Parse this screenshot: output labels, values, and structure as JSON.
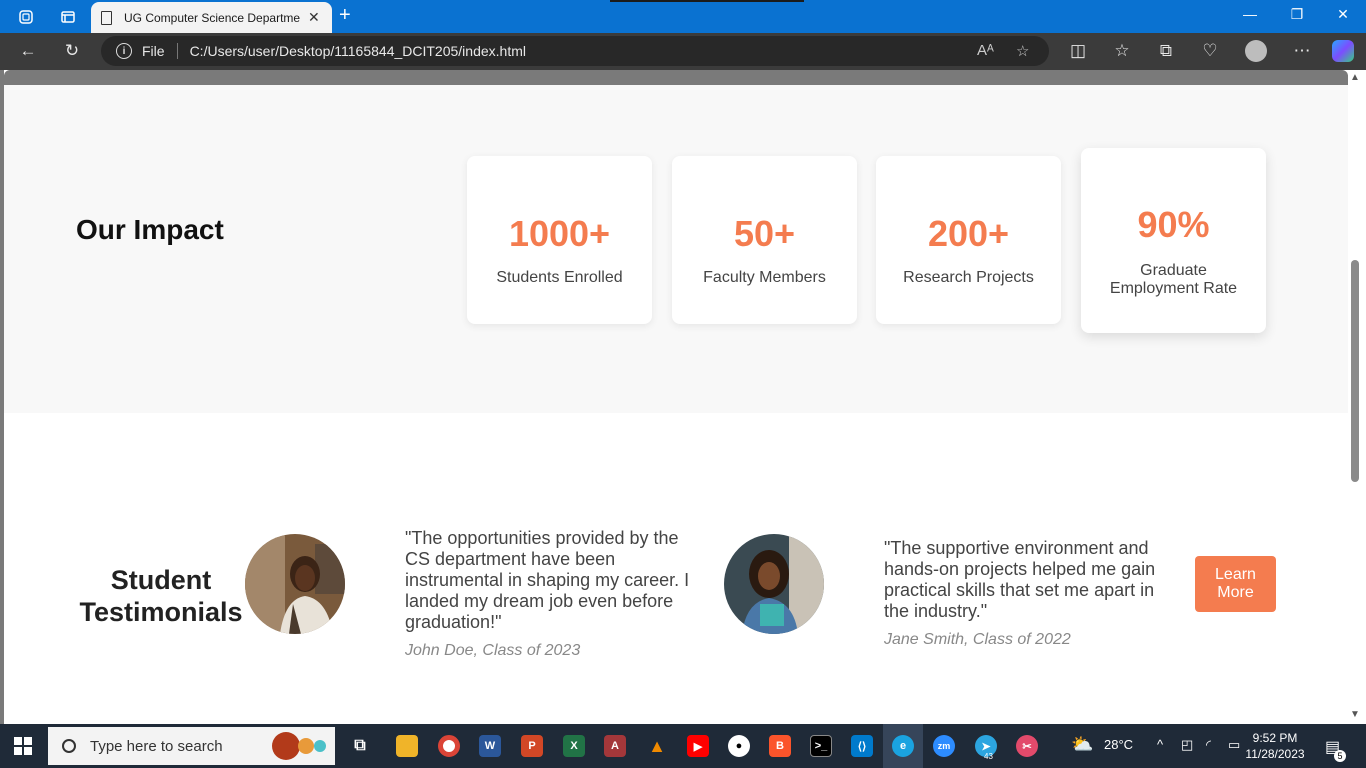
{
  "browser": {
    "tab_title": "UG Computer Science Departme",
    "url_scheme": "File",
    "url": "C:/Users/user/Desktop/11165844_DCIT205/index.html"
  },
  "impact": {
    "heading": "Our Impact",
    "stats": [
      {
        "number": "1000+",
        "label": "Students Enrolled"
      },
      {
        "number": "50+",
        "label": "Faculty Members"
      },
      {
        "number": "200+",
        "label": "Research Projects"
      },
      {
        "number": "90%",
        "label": "Graduate Employment Rate"
      }
    ]
  },
  "testimonials": {
    "heading": "Student Testimonials",
    "items": [
      {
        "quote": "\"The opportunities provided by the CS department have been instrumental in shaping my career. I landed my dream job even before graduation!\"",
        "author": "John Doe, Class of 2023"
      },
      {
        "quote": "\"The supportive environment and hands-on projects helped me gain practical skills that set me apart in the industry.\"",
        "author": "Jane Smith, Class of 2022"
      }
    ],
    "button_label": "Learn More"
  },
  "taskbar": {
    "search_placeholder": "Type here to search",
    "weather": "28°C",
    "time": "9:52 PM",
    "date": "11/28/2023",
    "notification_count": "5",
    "telegram_badge": "43"
  },
  "colors": {
    "accent": "#f47c4f",
    "tabbar": "#0a72d1",
    "taskbar": "#1f2a38"
  }
}
